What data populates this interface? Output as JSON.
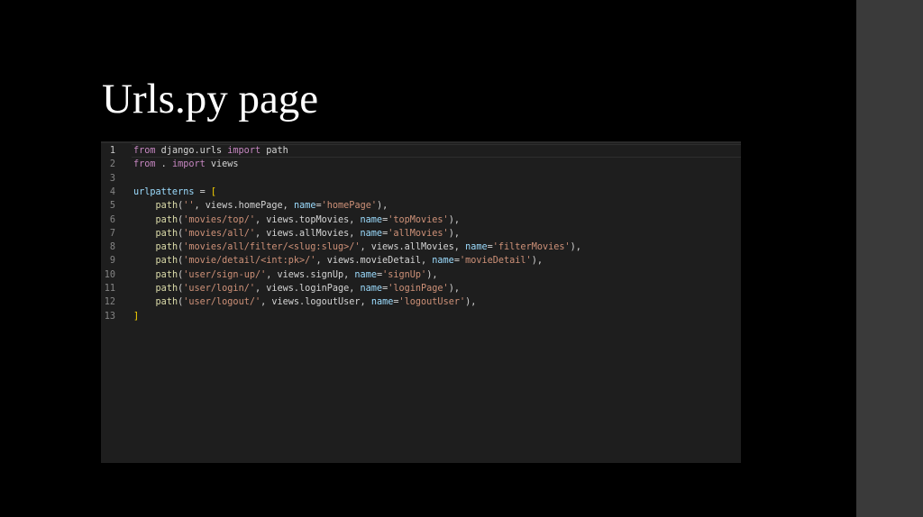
{
  "slide": {
    "title": "Urls.py page"
  },
  "colors": {
    "background": "#000000",
    "side_panel": "#3a3a3a",
    "editor_background": "#1e1e1e",
    "keyword": "#c586c0",
    "variable": "#9cdcfe",
    "function": "#dcdcaa",
    "string": "#ce9178",
    "bracket": "#ffd700",
    "line_number": "#858585"
  },
  "code": {
    "line_numbers": [
      "1",
      "2",
      "3",
      "4",
      "5",
      "6",
      "7",
      "8",
      "9",
      "10",
      "11",
      "12",
      "13"
    ],
    "lines": [
      [
        {
          "t": "from",
          "c": "import"
        },
        {
          "t": " django.urls ",
          "c": "plain"
        },
        {
          "t": "import",
          "c": "import"
        },
        {
          "t": " path",
          "c": "plain"
        }
      ],
      [
        {
          "t": "from",
          "c": "import"
        },
        {
          "t": " . ",
          "c": "plain"
        },
        {
          "t": "import",
          "c": "import"
        },
        {
          "t": " views",
          "c": "plain"
        }
      ],
      [],
      [
        {
          "t": "urlpatterns",
          "c": "var"
        },
        {
          "t": " = ",
          "c": "plain"
        },
        {
          "t": "[",
          "c": "br"
        }
      ],
      [
        {
          "t": "    ",
          "c": "plain"
        },
        {
          "t": "path",
          "c": "fn"
        },
        {
          "t": "(",
          "c": "plain"
        },
        {
          "t": "''",
          "c": "str"
        },
        {
          "t": ", views.",
          "c": "plain"
        },
        {
          "t": "homePage",
          "c": "plain"
        },
        {
          "t": ", ",
          "c": "plain"
        },
        {
          "t": "name",
          "c": "var"
        },
        {
          "t": "=",
          "c": "plain"
        },
        {
          "t": "'homePage'",
          "c": "str"
        },
        {
          "t": "),",
          "c": "plain"
        }
      ],
      [
        {
          "t": "    ",
          "c": "plain"
        },
        {
          "t": "path",
          "c": "fn"
        },
        {
          "t": "(",
          "c": "plain"
        },
        {
          "t": "'movies/top/'",
          "c": "str"
        },
        {
          "t": ", views.",
          "c": "plain"
        },
        {
          "t": "topMovies",
          "c": "plain"
        },
        {
          "t": ", ",
          "c": "plain"
        },
        {
          "t": "name",
          "c": "var"
        },
        {
          "t": "=",
          "c": "plain"
        },
        {
          "t": "'topMovies'",
          "c": "str"
        },
        {
          "t": "),",
          "c": "plain"
        }
      ],
      [
        {
          "t": "    ",
          "c": "plain"
        },
        {
          "t": "path",
          "c": "fn"
        },
        {
          "t": "(",
          "c": "plain"
        },
        {
          "t": "'movies/all/'",
          "c": "str"
        },
        {
          "t": ", views.",
          "c": "plain"
        },
        {
          "t": "allMovies",
          "c": "plain"
        },
        {
          "t": ", ",
          "c": "plain"
        },
        {
          "t": "name",
          "c": "var"
        },
        {
          "t": "=",
          "c": "plain"
        },
        {
          "t": "'allMovies'",
          "c": "str"
        },
        {
          "t": "),",
          "c": "plain"
        }
      ],
      [
        {
          "t": "    ",
          "c": "plain"
        },
        {
          "t": "path",
          "c": "fn"
        },
        {
          "t": "(",
          "c": "plain"
        },
        {
          "t": "'movies/all/filter/<slug:slug>/'",
          "c": "str"
        },
        {
          "t": ", views.",
          "c": "plain"
        },
        {
          "t": "allMovies",
          "c": "plain"
        },
        {
          "t": ", ",
          "c": "plain"
        },
        {
          "t": "name",
          "c": "var"
        },
        {
          "t": "=",
          "c": "plain"
        },
        {
          "t": "'filterMovies'",
          "c": "str"
        },
        {
          "t": "),",
          "c": "plain"
        }
      ],
      [
        {
          "t": "    ",
          "c": "plain"
        },
        {
          "t": "path",
          "c": "fn"
        },
        {
          "t": "(",
          "c": "plain"
        },
        {
          "t": "'movie/detail/<int:pk>/'",
          "c": "str"
        },
        {
          "t": ", views.",
          "c": "plain"
        },
        {
          "t": "movieDetail",
          "c": "plain"
        },
        {
          "t": ", ",
          "c": "plain"
        },
        {
          "t": "name",
          "c": "var"
        },
        {
          "t": "=",
          "c": "plain"
        },
        {
          "t": "'movieDetail'",
          "c": "str"
        },
        {
          "t": "),",
          "c": "plain"
        }
      ],
      [
        {
          "t": "    ",
          "c": "plain"
        },
        {
          "t": "path",
          "c": "fn"
        },
        {
          "t": "(",
          "c": "plain"
        },
        {
          "t": "'user/sign-up/'",
          "c": "str"
        },
        {
          "t": ", views.",
          "c": "plain"
        },
        {
          "t": "signUp",
          "c": "plain"
        },
        {
          "t": ", ",
          "c": "plain"
        },
        {
          "t": "name",
          "c": "var"
        },
        {
          "t": "=",
          "c": "plain"
        },
        {
          "t": "'signUp'",
          "c": "str"
        },
        {
          "t": "),",
          "c": "plain"
        }
      ],
      [
        {
          "t": "    ",
          "c": "plain"
        },
        {
          "t": "path",
          "c": "fn"
        },
        {
          "t": "(",
          "c": "plain"
        },
        {
          "t": "'user/login/'",
          "c": "str"
        },
        {
          "t": ", views.",
          "c": "plain"
        },
        {
          "t": "loginPage",
          "c": "plain"
        },
        {
          "t": ", ",
          "c": "plain"
        },
        {
          "t": "name",
          "c": "var"
        },
        {
          "t": "=",
          "c": "plain"
        },
        {
          "t": "'loginPage'",
          "c": "str"
        },
        {
          "t": "),",
          "c": "plain"
        }
      ],
      [
        {
          "t": "    ",
          "c": "plain"
        },
        {
          "t": "path",
          "c": "fn"
        },
        {
          "t": "(",
          "c": "plain"
        },
        {
          "t": "'user/logout/'",
          "c": "str"
        },
        {
          "t": ", views.",
          "c": "plain"
        },
        {
          "t": "logoutUser",
          "c": "plain"
        },
        {
          "t": ", ",
          "c": "plain"
        },
        {
          "t": "name",
          "c": "var"
        },
        {
          "t": "=",
          "c": "plain"
        },
        {
          "t": "'logoutUser'",
          "c": "str"
        },
        {
          "t": "),",
          "c": "plain"
        }
      ],
      [
        {
          "t": "]",
          "c": "br"
        }
      ]
    ]
  }
}
